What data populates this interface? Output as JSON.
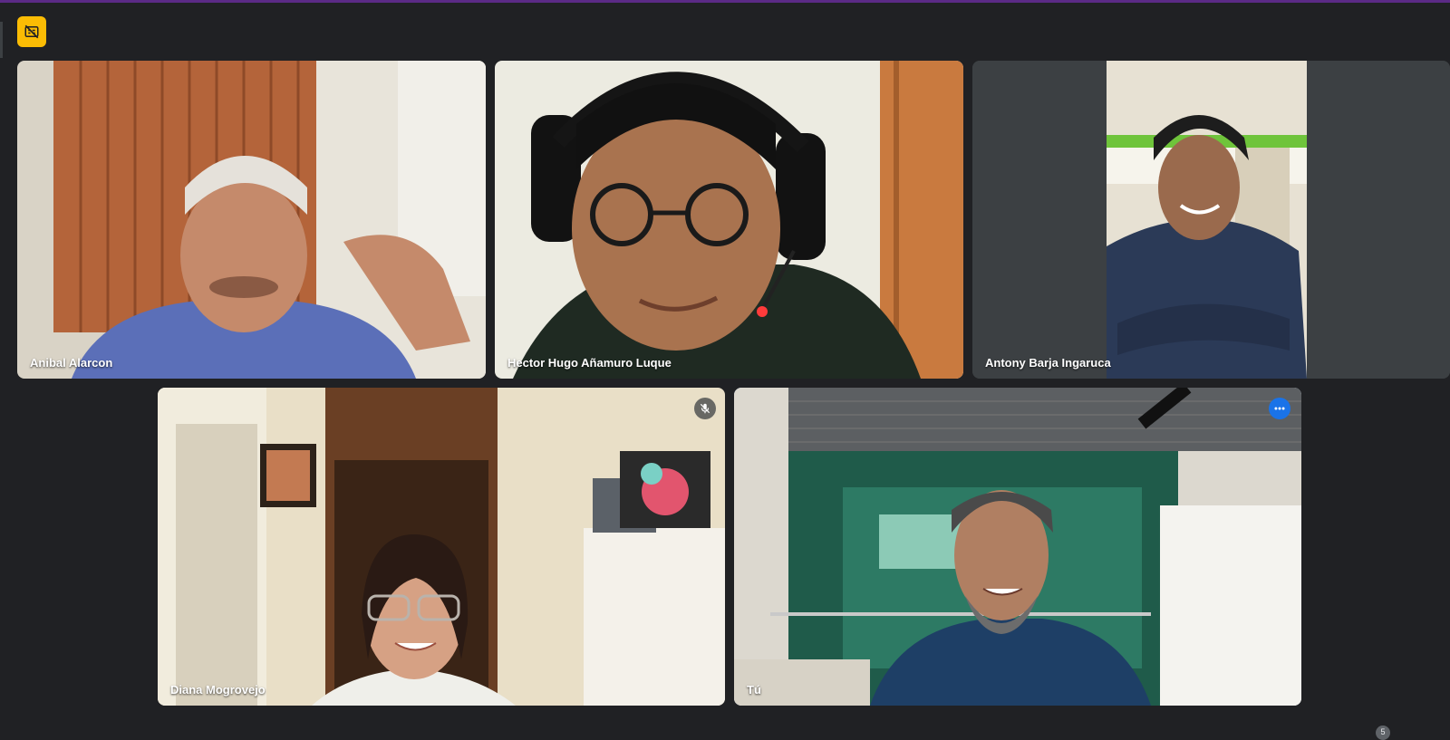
{
  "window": {
    "accent_color": "#5b2a86",
    "background": "#202124"
  },
  "captions_badge": {
    "icon": "captions-off-icon",
    "color": "#fbbc04"
  },
  "participants": [
    {
      "name": "Anibal Alarcon",
      "muted": false,
      "active_speaker": false
    },
    {
      "name": "Hector Hugo Añamuro Luque",
      "muted": false,
      "active_speaker": false
    },
    {
      "name": "Antony Barja Ingaruca",
      "muted": false,
      "active_speaker": false
    },
    {
      "name": "Diana Mogrovejo",
      "muted": true,
      "active_speaker": false
    },
    {
      "name": "Tú",
      "muted": false,
      "active_speaker": true,
      "is_self": true
    }
  ],
  "pagination": {
    "label": "5"
  }
}
